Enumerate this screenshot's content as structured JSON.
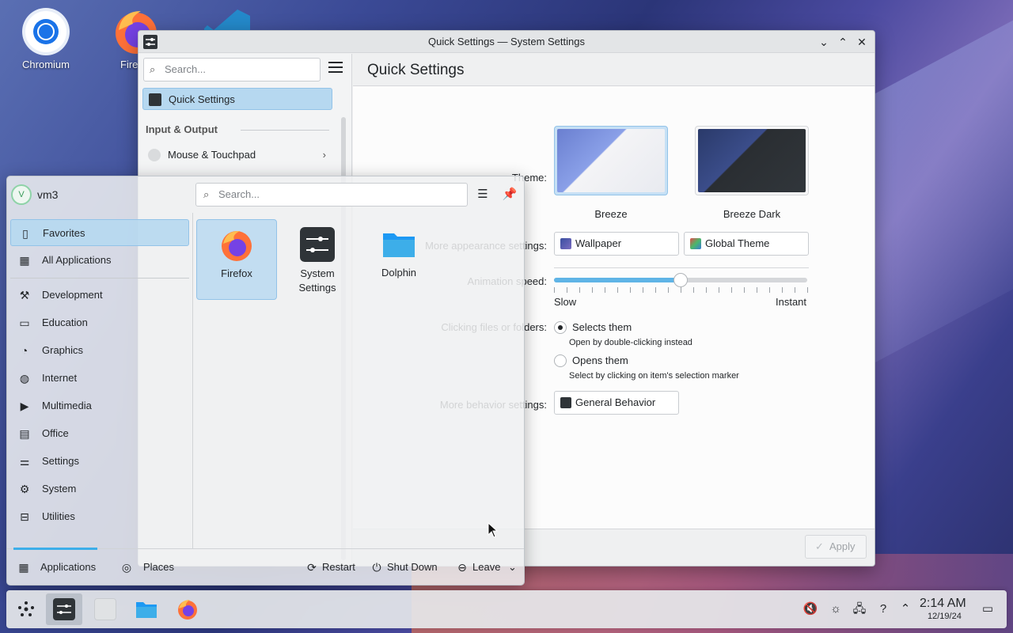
{
  "desktop": {
    "icons": [
      {
        "label": "Chromium",
        "icon": "chromium-icon"
      },
      {
        "label": "Fire",
        "icon": "firefox-icon"
      },
      {
        "label": "",
        "icon": "vscode-icon"
      }
    ]
  },
  "settings_window": {
    "title": "Quick Settings — System Settings",
    "search_placeholder": "Search...",
    "page_title": "Quick Settings",
    "sidebar": {
      "active_item": "Quick Settings",
      "section_input_output": "Input & Output",
      "mouse_touchpad": "Mouse & Touchpad"
    },
    "theme_label": "Theme:",
    "themes": [
      {
        "name": "Breeze",
        "selected": true
      },
      {
        "name": "Breeze Dark",
        "selected": false
      }
    ],
    "more_appearance_label": "More appearance settings:",
    "wallpaper_button": "Wallpaper",
    "global_theme_button": "Global Theme",
    "animation_label": "Animation speed:",
    "animation_speed_fraction": 0.5,
    "slow_label": "Slow",
    "instant_label": "Instant",
    "clicking_label": "Clicking files or folders:",
    "option_selects": "Selects them",
    "option_selects_sub": "Open by double-clicking instead",
    "option_opens": "Opens them",
    "option_opens_sub": "Select by clicking on item's selection marker",
    "selected_option": "Selects them",
    "more_behavior_label": "More behavior settings:",
    "general_behavior_button": "General Behavior",
    "apply_button": "Apply"
  },
  "launcher": {
    "user_initial": "V",
    "username": "vm3",
    "search_placeholder": "Search...",
    "categories": [
      {
        "label": "Favorites",
        "icon": "bookmark-icon",
        "active": true
      },
      {
        "label": "All Applications",
        "icon": "grid-icon",
        "active": false
      },
      {
        "label": "Development",
        "icon": "hammer-icon",
        "active": false
      },
      {
        "label": "Education",
        "icon": "education-icon",
        "active": false
      },
      {
        "label": "Graphics",
        "icon": "graphics-icon",
        "active": false
      },
      {
        "label": "Internet",
        "icon": "globe-icon",
        "active": false
      },
      {
        "label": "Multimedia",
        "icon": "multimedia-icon",
        "active": false
      },
      {
        "label": "Office",
        "icon": "office-icon",
        "active": false
      },
      {
        "label": "Settings",
        "icon": "sliders-icon",
        "active": false
      },
      {
        "label": "System",
        "icon": "gear-icon",
        "active": false
      },
      {
        "label": "Utilities",
        "icon": "toolbox-icon",
        "active": false
      }
    ],
    "favorites": [
      {
        "label": "Firefox",
        "icon": "firefox-icon"
      },
      {
        "label": "System\nSettings",
        "icon": "system-settings-icon"
      },
      {
        "label": "Dolphin",
        "icon": "folder-icon"
      }
    ],
    "footer": {
      "applications": "Applications",
      "places": "Places",
      "restart": "Restart",
      "shutdown": "Shut Down",
      "leave": "Leave"
    }
  },
  "taskbar": {
    "time": "2:14 AM",
    "date": "12/19/24"
  },
  "colors": {
    "accent": "#3daee9",
    "selection": "#b6d8f0"
  }
}
